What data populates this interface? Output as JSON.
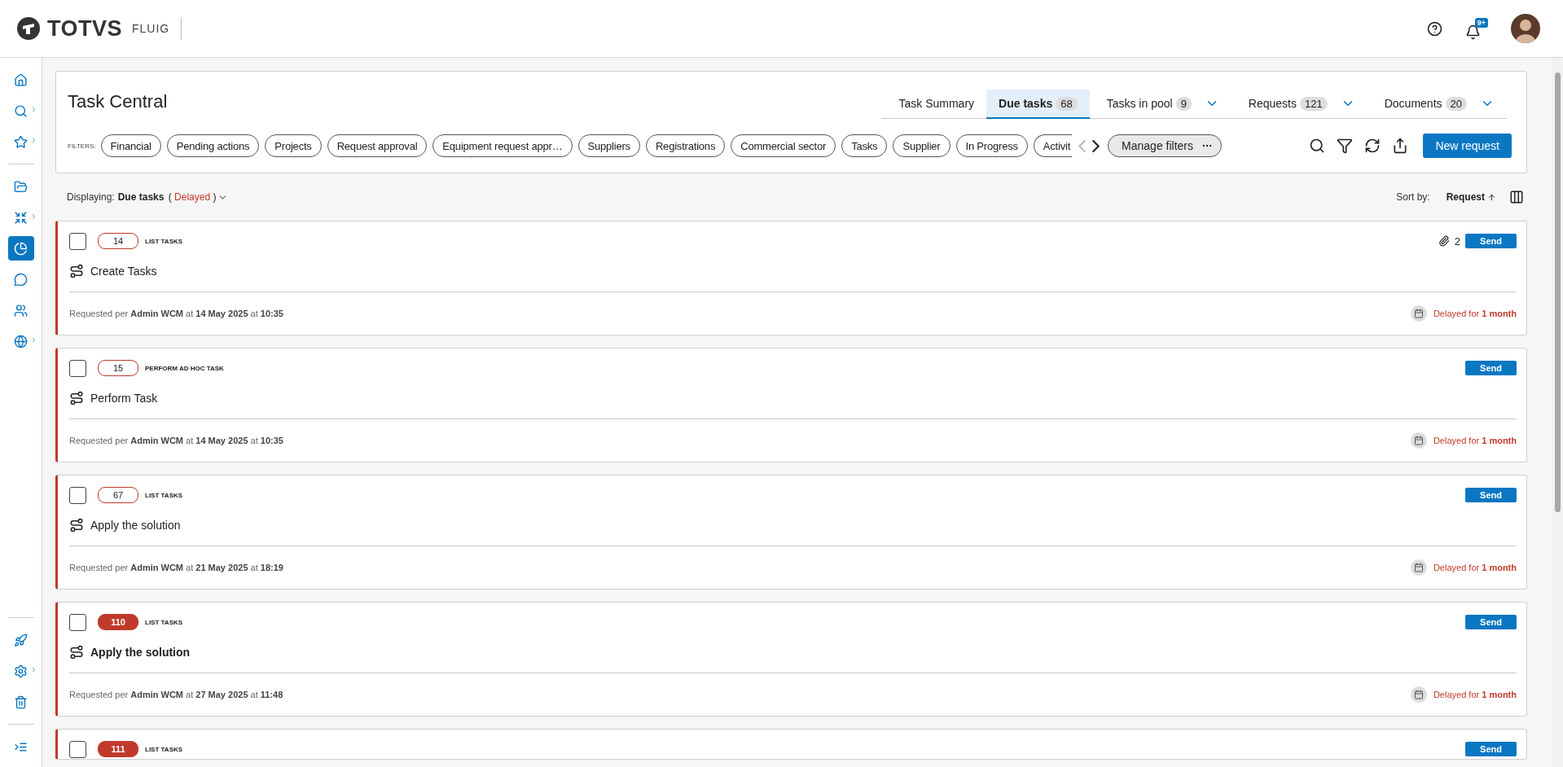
{
  "header": {
    "brand": "TOTVS",
    "product": "FLUIG",
    "notification_count": "9+"
  },
  "sidebar": {
    "groups": [
      {
        "items": [
          {
            "selected": false,
            "submenu": false
          },
          {
            "selected": false,
            "submenu": true
          },
          {
            "selected": false,
            "submenu": true
          }
        ]
      },
      {
        "items": [
          {
            "selected": false,
            "submenu": false
          },
          {
            "selected": false,
            "submenu": true
          },
          {
            "selected": true,
            "submenu": false
          },
          {
            "selected": false,
            "submenu": false
          },
          {
            "selected": false,
            "submenu": false
          },
          {
            "selected": false,
            "submenu": true
          }
        ]
      }
    ],
    "bottom_groups": [
      {
        "items": [
          {
            "selected": false,
            "submenu": false
          },
          {
            "selected": false,
            "submenu": true
          },
          {
            "selected": false,
            "submenu": false
          }
        ]
      },
      {
        "items": [
          {
            "selected": false,
            "submenu": false
          }
        ]
      }
    ]
  },
  "panel": {
    "title": "Task Central",
    "tabs": [
      {
        "label": "Task Summary",
        "selected": false,
        "dropdown": false
      },
      {
        "label": "Due tasks",
        "count": "68",
        "selected": true,
        "dropdown": false
      },
      {
        "label": "Tasks in pool",
        "count": "9",
        "selected": false,
        "dropdown": true
      },
      {
        "label": "Requests",
        "count": "121",
        "selected": false,
        "dropdown": true
      },
      {
        "label": "Documents",
        "count": "20",
        "selected": false,
        "dropdown": true
      }
    ],
    "filters_label": "FILTERS:",
    "filters": [
      {
        "label": "Financial",
        "cut": false
      },
      {
        "label": "Pending actions",
        "cut": false
      },
      {
        "label": "Projects",
        "cut": false
      },
      {
        "label": "Request approval",
        "cut": false
      },
      {
        "label": "Equipment request appr…",
        "cut": false
      },
      {
        "label": "Suppliers",
        "cut": false
      },
      {
        "label": "Registrations",
        "cut": false
      },
      {
        "label": "Commercial sector",
        "cut": false
      },
      {
        "label": "Tasks",
        "cut": false
      },
      {
        "label": "Supplier",
        "cut": false
      },
      {
        "label": "In Progress",
        "cut": false
      },
      {
        "label": "Activit",
        "cut": true
      }
    ],
    "prev_disabled": true,
    "manage_filters": "Manage filters",
    "new_request": "New request"
  },
  "listing": {
    "label": "Displaying:",
    "view": "Due tasks",
    "status": "( **Delayed** )",
    "sort_label": "Sort by:",
    "sort_value": "Request"
  },
  "tasks": [
    {
      "number": "14",
      "type": "LIST TASKS",
      "title": "Create Tasks",
      "unread": false,
      "checked": false,
      "attachments": "2",
      "action": "Send",
      "requested": "Requested per **Admin WCM** at **14 May 2025** at **10:35**",
      "delay": "Delayed for **1 month**"
    },
    {
      "number": "15",
      "type": "PERFORM AD HOC TASK",
      "title": "Perform Task",
      "unread": false,
      "checked": false,
      "action": "Send",
      "requested": "Requested per **Admin WCM** at **14 May 2025** at **10:35**",
      "delay": "Delayed for **1 month**"
    },
    {
      "number": "67",
      "type": "LIST TASKS",
      "title": "Apply the solution",
      "unread": false,
      "checked": false,
      "action": "Send",
      "requested": "Requested per **Admin WCM** at **21 May 2025** at **18:19**",
      "delay": "Delayed for **1 month**"
    },
    {
      "number": "110",
      "type": "LIST TASKS",
      "title": "Apply the solution",
      "unread": true,
      "checked": false,
      "action": "Send",
      "requested": "Requested per **Admin WCM** at **27 May 2025** at **11:48**",
      "delay": "Delayed for **1 month**"
    },
    {
      "number": "111",
      "type": "LIST TASKS",
      "unread": true,
      "checked": false,
      "action": "Send"
    }
  ]
}
